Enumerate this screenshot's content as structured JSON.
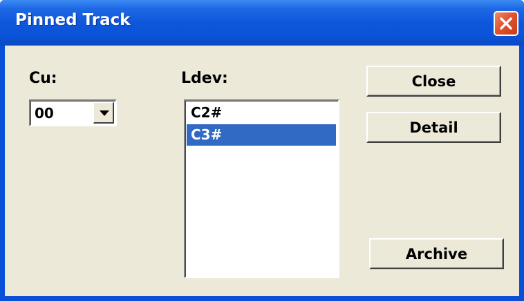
{
  "window": {
    "title": "Pinned Track",
    "close_icon": "close-icon",
    "colors": {
      "titlebar": "#0a52d6",
      "client": "#ece9d8",
      "close_button": "#e0552f",
      "selection": "#316ac5"
    }
  },
  "cu": {
    "label": "Cu:",
    "value": "00",
    "dropdown_icon": "chevron-down-icon"
  },
  "ldev": {
    "label": "Ldev:",
    "items": [
      {
        "label": "C2#",
        "selected": false
      },
      {
        "label": "C3#",
        "selected": true
      }
    ]
  },
  "buttons": {
    "close": "Close",
    "detail": "Detail",
    "archive": "Archive"
  }
}
